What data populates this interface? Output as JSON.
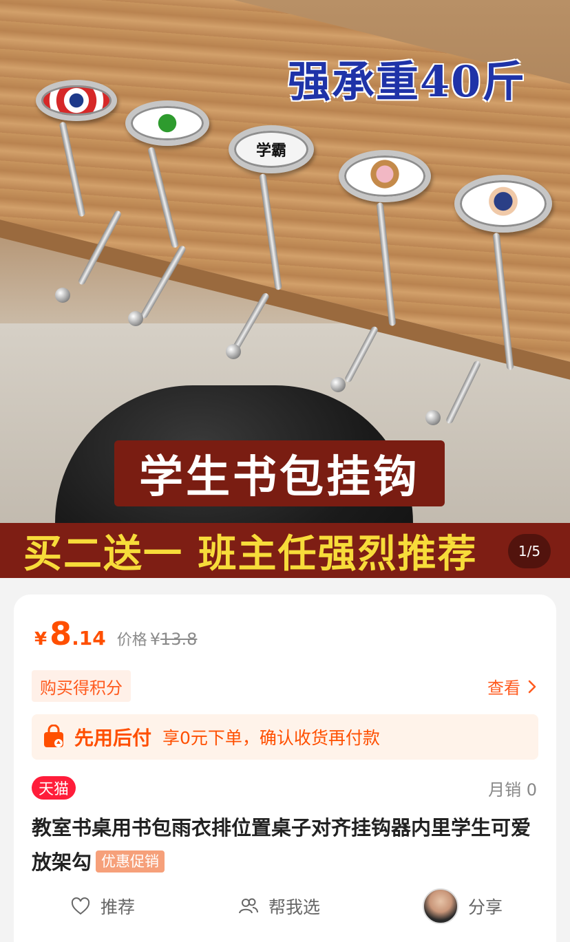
{
  "hero": {
    "heavy_text": "强承重40斤",
    "title_banner": "学生书包挂钩",
    "bottom_banner": "买二送一  班主任强烈推荐",
    "badge_text": "学霸",
    "page_indicator": "1/5"
  },
  "price": {
    "currency": "¥",
    "integer": "8",
    "decimal": ".14",
    "original_label": "价格",
    "original_currency": "¥",
    "original_value": "13.8"
  },
  "points": {
    "label": "购买得积分",
    "view_label": "查看"
  },
  "pay_later": {
    "title": "先用后付",
    "desc": "享0元下单，确认收货再付款"
  },
  "store": {
    "badge": "天猫",
    "sales": "月销 0"
  },
  "product": {
    "title": "教室书桌用书包雨衣排位置桌子对齐挂钩器内里学生可爱放架勾",
    "promo_tag": "优惠促销"
  },
  "actions": {
    "recommend": "推荐",
    "help_choose": "帮我选",
    "share": "分享"
  },
  "colors": {
    "accent": "#ff4f00",
    "tmall_red": "#ff1d3a",
    "banner_red": "#7e1e14",
    "banner_yellow": "#f7dc3a",
    "heavy_blue": "#1f33a8"
  }
}
